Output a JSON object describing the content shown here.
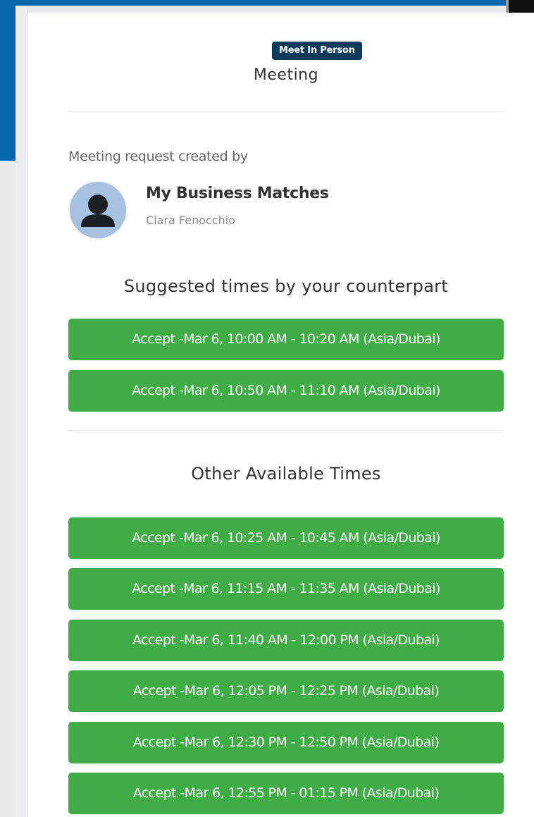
{
  "header": {
    "badge": "Meet In Person",
    "title": "Meeting"
  },
  "request": {
    "label": "Meeting request created by",
    "company": "My Business Matches",
    "person": "Clara Fenocchio",
    "avatar_icon": "user-silhouette-icon"
  },
  "suggested": {
    "heading": "Suggested times by your counterpart",
    "slots": [
      "Accept -Mar 6, 10:00 AM - 10:20 AM (Asia/Dubai)",
      "Accept -Mar 6, 10:50 AM - 11:10 AM (Asia/Dubai)"
    ]
  },
  "other": {
    "heading": "Other Available Times",
    "slots": [
      "Accept -Mar 6, 10:25 AM - 10:45 AM (Asia/Dubai)",
      "Accept -Mar 6, 11:15 AM - 11:35 AM (Asia/Dubai)",
      "Accept -Mar 6, 11:40 AM - 12:00 PM (Asia/Dubai)",
      "Accept -Mar 6, 12:05 PM - 12:25 PM (Asia/Dubai)",
      "Accept -Mar 6, 12:30 PM - 12:50 PM (Asia/Dubai)",
      "Accept -Mar 6, 12:55 PM - 01:15 PM (Asia/Dubai)"
    ]
  },
  "colors": {
    "accept_button": "#3fac46",
    "badge": "#0d3b5c",
    "brand_blue": "#0a66ad",
    "avatar_bg": "#a6c1e0"
  }
}
